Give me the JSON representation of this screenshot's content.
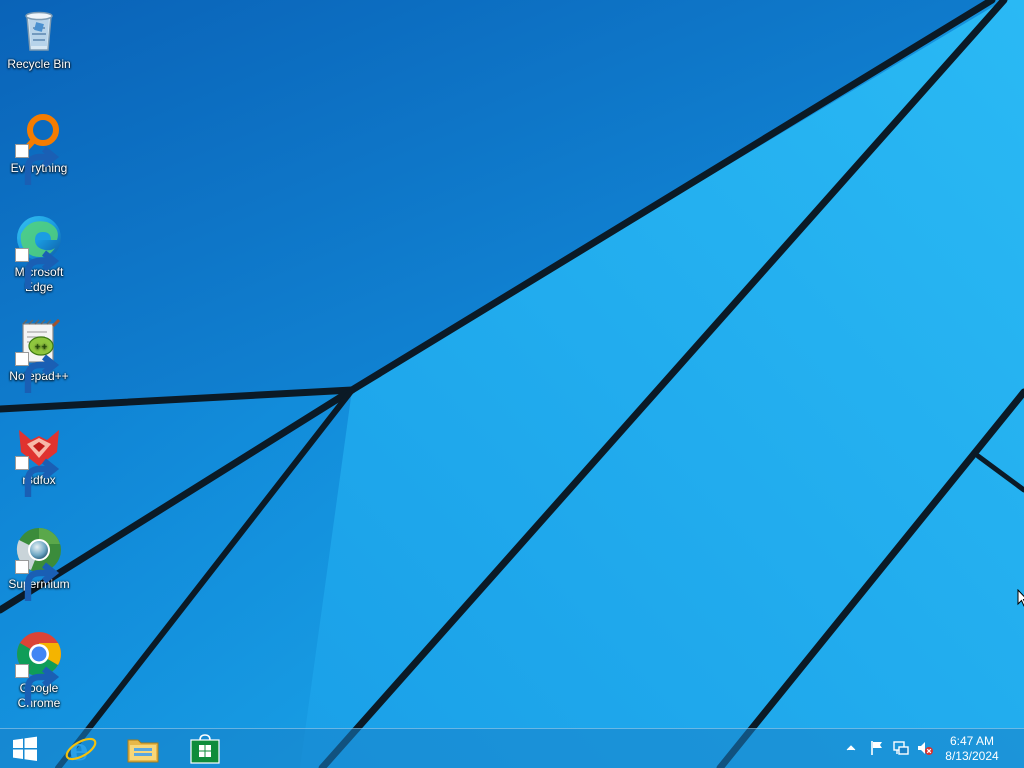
{
  "desktop": {
    "icons": [
      {
        "label": "Recycle Bin",
        "icon": "recycle-bin-icon",
        "shortcut": false
      },
      {
        "label": "Everything",
        "icon": "everything-search-icon",
        "shortcut": true
      },
      {
        "label": "Microsoft Edge",
        "icon": "edge-icon",
        "shortcut": true
      },
      {
        "label": "Notepad++",
        "icon": "notepad-plus-plus-icon",
        "shortcut": true
      },
      {
        "label": "r3dfox",
        "icon": "r3dfox-icon",
        "shortcut": true
      },
      {
        "label": "Supermium",
        "icon": "supermium-icon",
        "shortcut": true
      },
      {
        "label": "Google Chrome",
        "icon": "chrome-icon",
        "shortcut": true
      }
    ]
  },
  "taskbar": {
    "start": {
      "icon": "windows-start-icon"
    },
    "pinned": [
      {
        "name": "Internet Explorer",
        "icon": "internet-explorer-icon"
      },
      {
        "name": "File Explorer",
        "icon": "file-explorer-icon"
      },
      {
        "name": "Store",
        "icon": "store-icon"
      }
    ],
    "tray": {
      "icons": [
        "show-hidden-icons-chevron",
        "action-center-flag-icon",
        "network-icon",
        "volume-muted-icon"
      ],
      "time": "6:47 AM",
      "date": "8/13/2024"
    }
  },
  "colors": {
    "wallpaper_light": "#22b4f2",
    "wallpaper_dark": "#0a72c8",
    "line": "#0b1a26"
  }
}
